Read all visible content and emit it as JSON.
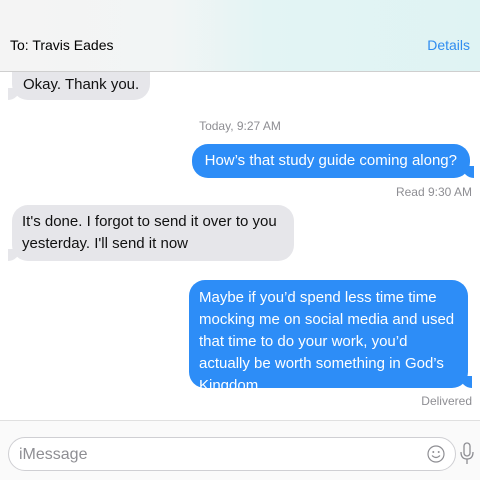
{
  "header": {
    "to_label": "To:  Travis Eades",
    "details_label": "Details"
  },
  "messages": [
    {
      "direction": "incoming",
      "text": "Okay. Thank you."
    },
    {
      "direction": "outgoing",
      "text": "How’s that study guide coming along?"
    },
    {
      "direction": "incoming",
      "text": "It's done. I forgot to send it over to you yesterday. I'll send it now"
    },
    {
      "direction": "outgoing",
      "text": "Maybe if you’d spend less time time mocking me on social media and used that time to do your work, you’d actually be worth something in God’s Kingdom."
    }
  ],
  "timestamp": "Today, 9:27 AM",
  "read_receipt": "Read 9:30 AM",
  "delivered_status": "Delivered",
  "compose": {
    "placeholder": "iMessage",
    "emoji_icon": "smiley-icon",
    "mic_icon": "microphone-icon"
  },
  "colors": {
    "outgoing_bubble": "#2d8df7",
    "incoming_bubble": "#e6e6ea",
    "accent": "#2f8cf0",
    "meta_text": "#8e8e93"
  }
}
